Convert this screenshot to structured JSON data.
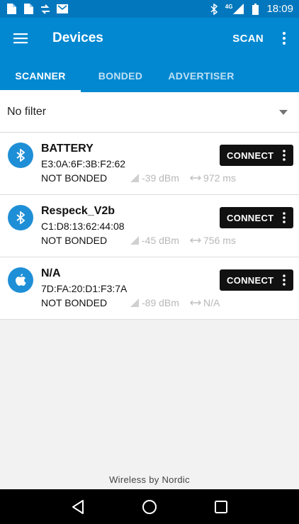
{
  "status_bar": {
    "time": "18:09",
    "network": "4G",
    "left_icons": [
      "file-icon",
      "file-icon",
      "swap-icon",
      "mail-icon"
    ],
    "right_icons": [
      "bluetooth-icon",
      "signal-icon",
      "battery-icon"
    ]
  },
  "app_bar": {
    "title": "Devices",
    "scan_label": "SCAN"
  },
  "tabs": [
    {
      "label": "SCANNER",
      "active": true
    },
    {
      "label": "BONDED",
      "active": false
    },
    {
      "label": "ADVERTISER",
      "active": false
    }
  ],
  "filter": {
    "label": "No filter"
  },
  "devices": [
    {
      "name": "BATTERY",
      "address": "E3:0A:6F:3B:F2:62",
      "bond_state": "NOT BONDED",
      "rssi": "-39 dBm",
      "interval": "972 ms",
      "icon": "bluetooth-icon",
      "action_label": "CONNECT"
    },
    {
      "name": "Respeck_V2b",
      "address": "C1:D8:13:62:44:08",
      "bond_state": "NOT BONDED",
      "rssi": "-45 dBm",
      "interval": "756 ms",
      "icon": "bluetooth-icon",
      "action_label": "CONNECT"
    },
    {
      "name": "N/A",
      "address": "7D:FA:20:D1:F3:7A",
      "bond_state": "NOT BONDED",
      "rssi": "-89 dBm",
      "interval": "N/A",
      "icon": "apple-icon",
      "action_label": "CONNECT"
    }
  ],
  "footer": {
    "text": "Wireless by Nordic"
  },
  "colors": {
    "status_bar": "#0277bd",
    "app_bar": "#0288d1",
    "avatar": "#1e8fd6",
    "connect_button": "#111111"
  }
}
